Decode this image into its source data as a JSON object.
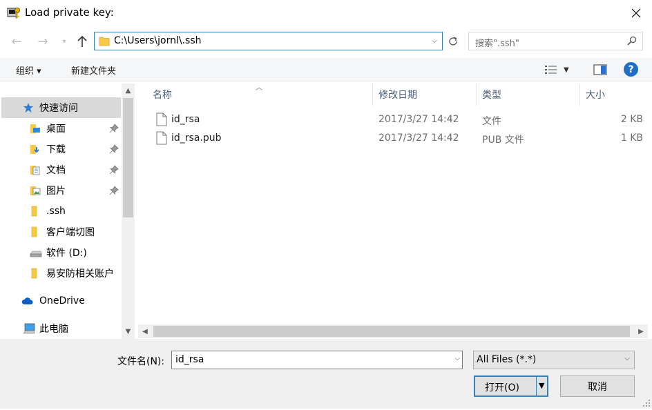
{
  "window": {
    "title": "Load private key:"
  },
  "address": {
    "path": "C:\\Users\\jornl\\.ssh"
  },
  "search": {
    "placeholder": "搜索\".ssh\""
  },
  "toolbar": {
    "organize_label": "组织 ▾",
    "new_folder_label": "新建文件夹"
  },
  "nav": {
    "items": [
      {
        "label": "快速访问",
        "icon": "star-icon"
      },
      {
        "label": "桌面",
        "icon": "desktop-folder-icon"
      },
      {
        "label": "下载",
        "icon": "download-folder-icon"
      },
      {
        "label": "文档",
        "icon": "documents-folder-icon"
      },
      {
        "label": "图片",
        "icon": "pictures-folder-icon"
      },
      {
        "label": ".ssh",
        "icon": "folder-icon"
      },
      {
        "label": "客户端切图",
        "icon": "folder-icon"
      },
      {
        "label": "软件 (D:)",
        "icon": "drive-icon"
      },
      {
        "label": "易安防相关账户",
        "icon": "folder-icon"
      },
      {
        "label": "OneDrive",
        "icon": "cloud-icon"
      },
      {
        "label": "此电脑",
        "icon": "computer-icon"
      }
    ]
  },
  "file_list": {
    "columns": {
      "name": "名称",
      "modified": "修改日期",
      "type": "类型",
      "size": "大小"
    },
    "rows": [
      {
        "name": "id_rsa",
        "modified": "2017/3/27 14:42",
        "type": "文件",
        "size": "2 KB"
      },
      {
        "name": "id_rsa.pub",
        "modified": "2017/3/27 14:42",
        "type": "PUB 文件",
        "size": "1 KB"
      }
    ]
  },
  "bottom": {
    "filename_label": "文件名(N):",
    "filename_value": "id_rsa",
    "filetype_value": "All Files (*.*)",
    "open_label": "打开(O)",
    "cancel_label": "取消"
  },
  "colors": {
    "accent": "#3c7fb1",
    "selected_nav": "#d9d9d9",
    "help": "#1f6fc5"
  }
}
